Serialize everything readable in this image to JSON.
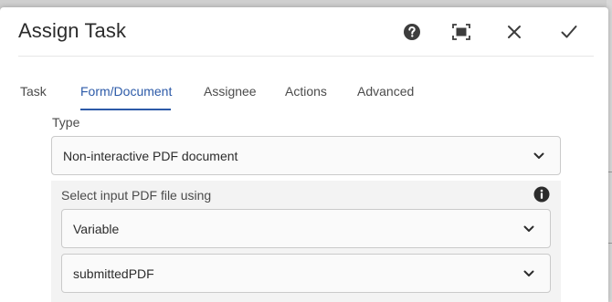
{
  "dialog": {
    "title": "Assign Task",
    "header_buttons": [
      {
        "name": "help",
        "icon": "help-circle-icon"
      },
      {
        "name": "fullscreen",
        "icon": "fullscreen-icon"
      },
      {
        "name": "close",
        "icon": "close-icon"
      },
      {
        "name": "done",
        "icon": "checkmark-icon"
      }
    ]
  },
  "tabs": [
    {
      "label": "Task",
      "active": false
    },
    {
      "label": "Form/Document",
      "active": true
    },
    {
      "label": "Assignee",
      "active": false
    },
    {
      "label": "Actions",
      "active": false
    },
    {
      "label": "Advanced",
      "active": false
    }
  ],
  "form": {
    "type_label": "Type",
    "type_value": "Non-interactive PDF document",
    "pdf_section": {
      "label": "Select input PDF file using",
      "info_icon": "info-icon",
      "source_value": "Variable",
      "variable_value": "submittedPDF"
    }
  },
  "colors": {
    "accent": "#2c5aa8",
    "text": "#2c2c2c",
    "field_bg": "#fafafa",
    "section_bg": "#f3f3f3"
  }
}
